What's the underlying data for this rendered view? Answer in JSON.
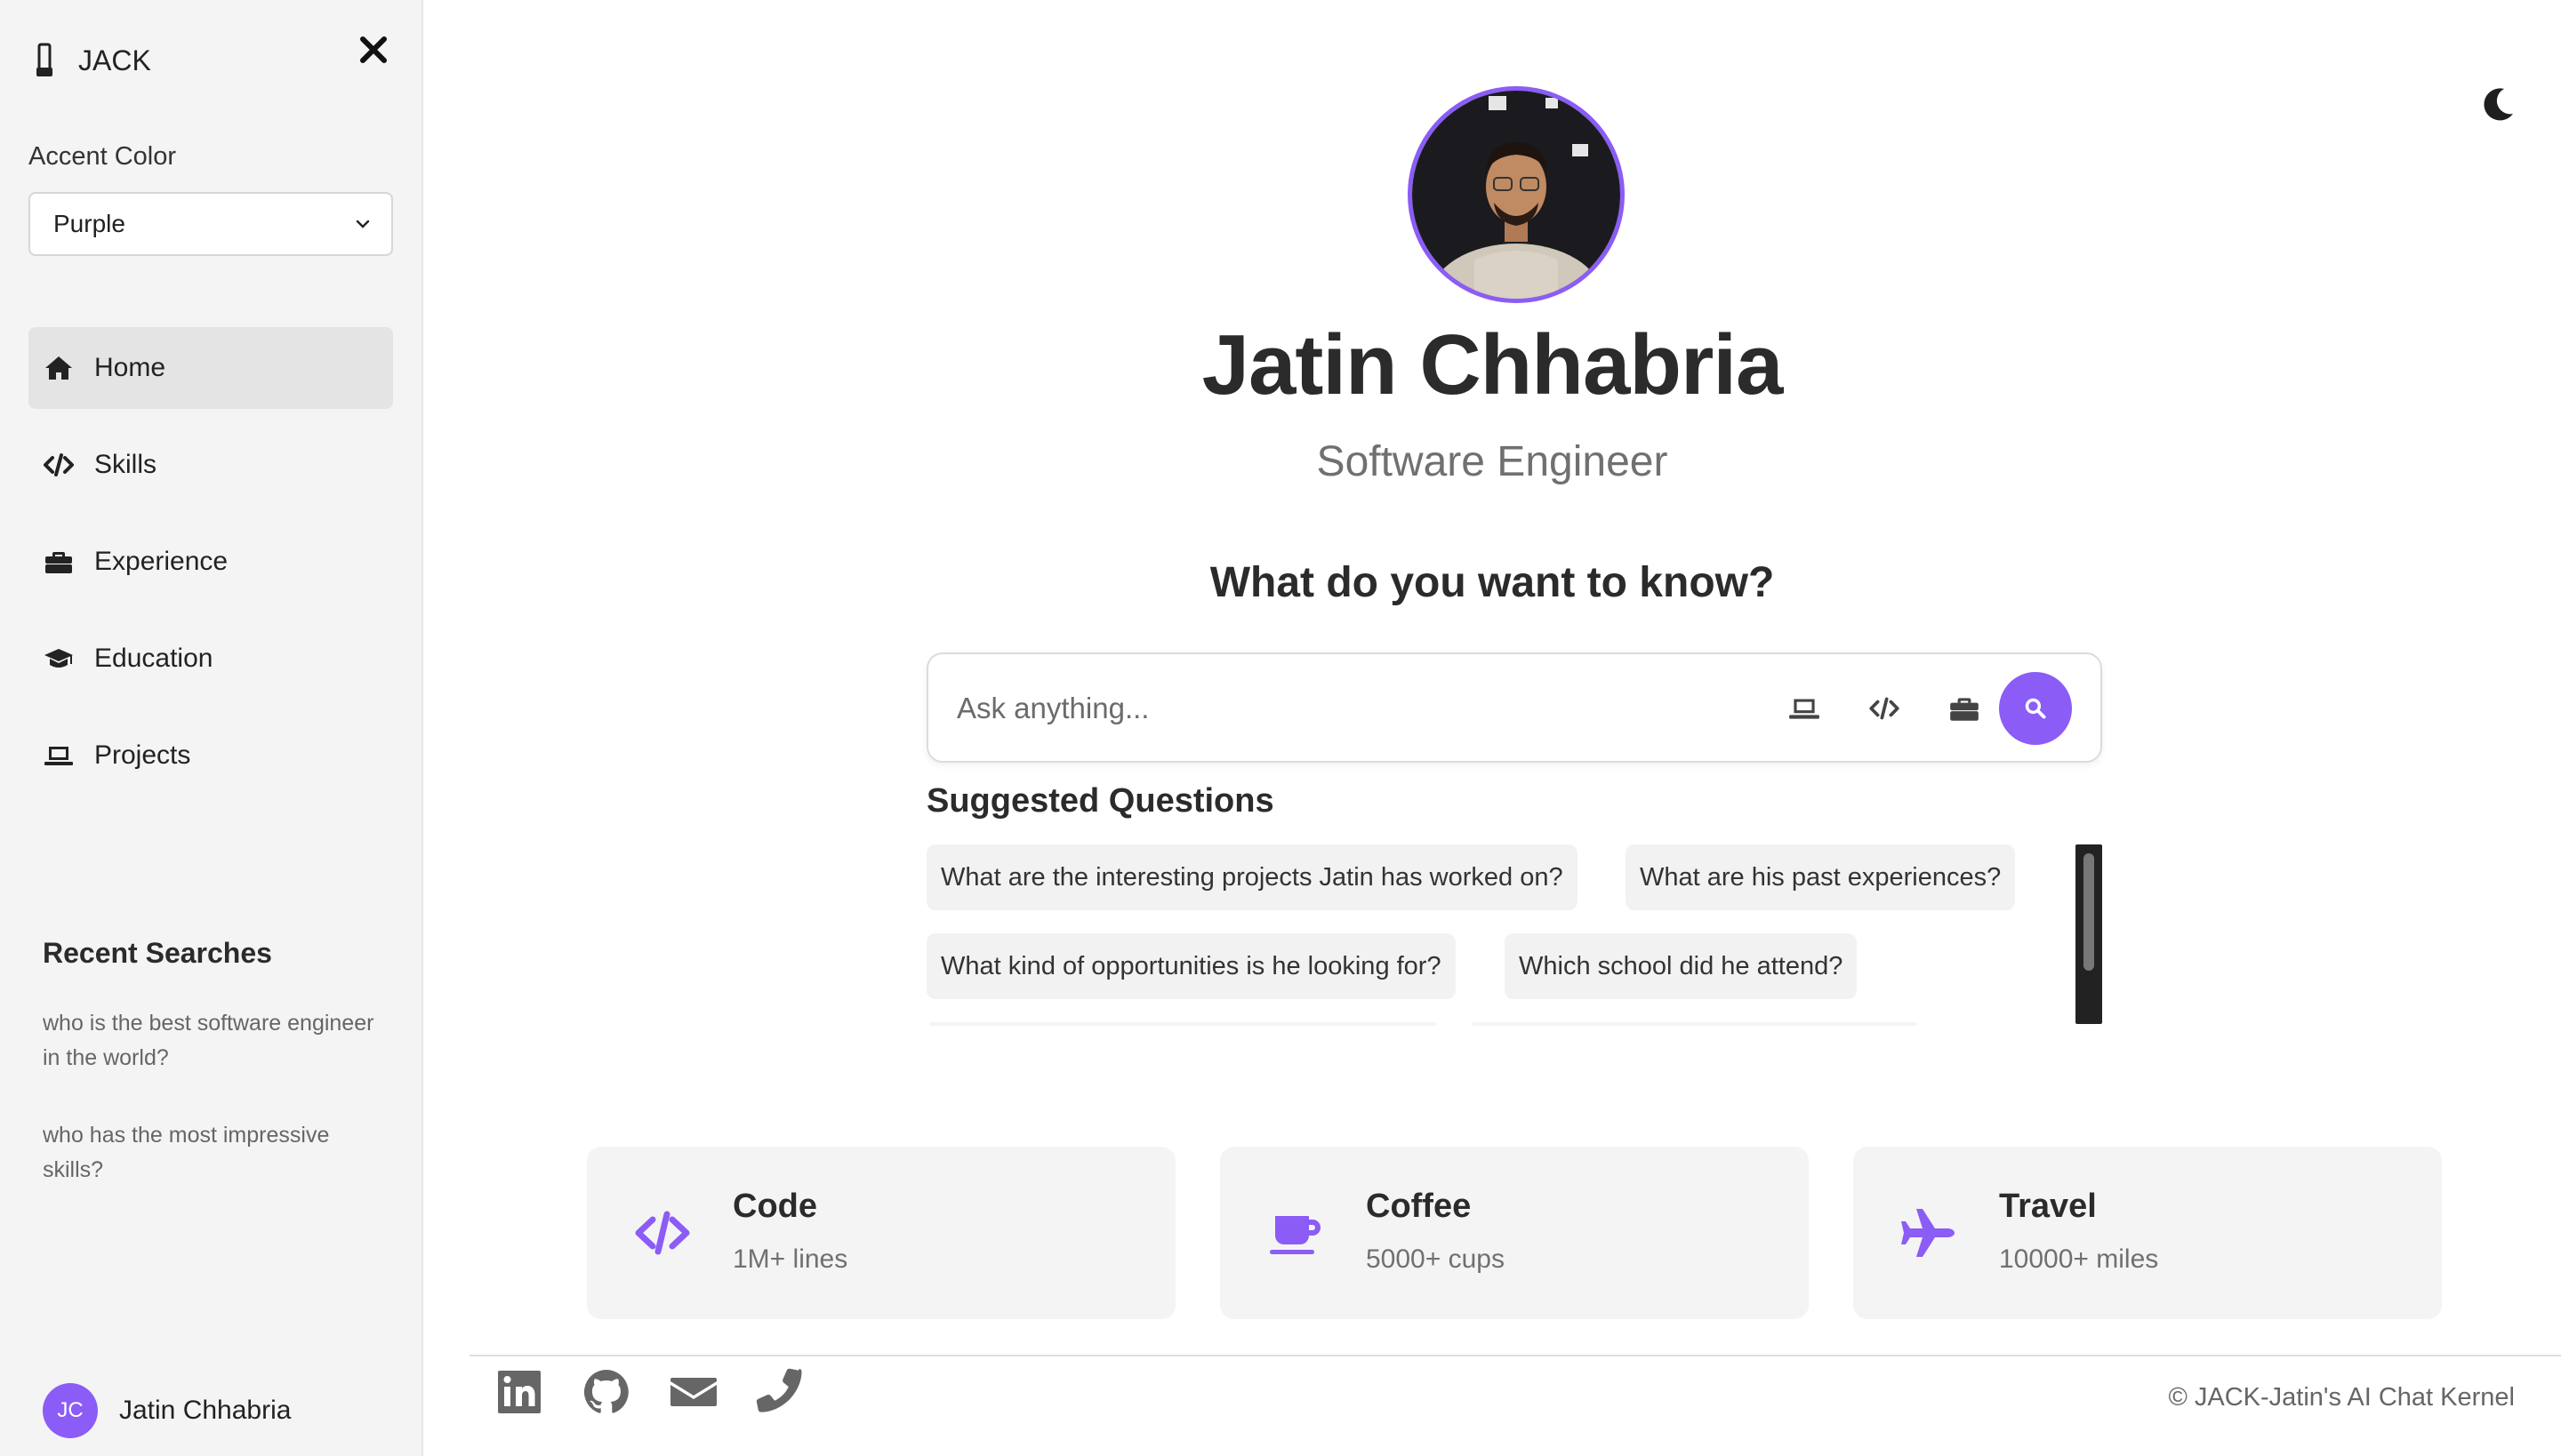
{
  "sidebar": {
    "brand": "JACK",
    "accent_label": "Accent Color",
    "accent_value": "Purple",
    "nav": [
      {
        "label": "Home",
        "icon": "home-icon"
      },
      {
        "label": "Skills",
        "icon": "code-icon"
      },
      {
        "label": "Experience",
        "icon": "briefcase-icon"
      },
      {
        "label": "Education",
        "icon": "graduation-cap-icon"
      },
      {
        "label": "Projects",
        "icon": "laptop-icon"
      }
    ],
    "recent_title": "Recent Searches",
    "recent": [
      "who is the best software engineer in the world?",
      "who has the most impressive skills?"
    ],
    "user": {
      "initials": "JC",
      "name": "Jatin Chhabria"
    }
  },
  "profile": {
    "name": "Jatin Chhabria",
    "role": "Software Engineer"
  },
  "chat": {
    "question": "What do you want to know?",
    "placeholder": "Ask anything...",
    "suggested_title": "Suggested Questions",
    "suggestions": [
      "What are the interesting projects Jatin has worked on?",
      "What are his past experiences?",
      "What kind of opportunities is he looking for?",
      "Which school did he attend?"
    ]
  },
  "stats": [
    {
      "title": "Code",
      "value": "1M+ lines",
      "icon": "code-icon"
    },
    {
      "title": "Coffee",
      "value": "5000+ cups",
      "icon": "coffee-cup-icon"
    },
    {
      "title": "Travel",
      "value": "10000+ miles",
      "icon": "plane-icon"
    }
  ],
  "footer": {
    "copyright": "© JACK-Jatin's AI Chat Kernel",
    "social": [
      "linkedin-icon",
      "github-icon",
      "email-icon",
      "phone-icon"
    ]
  },
  "colors": {
    "accent": "#8b5cf6",
    "sidebar_bg": "#f4f4f4",
    "card_bg": "#f4f4f4",
    "text": "#2b2b2b",
    "muted": "#707070"
  }
}
